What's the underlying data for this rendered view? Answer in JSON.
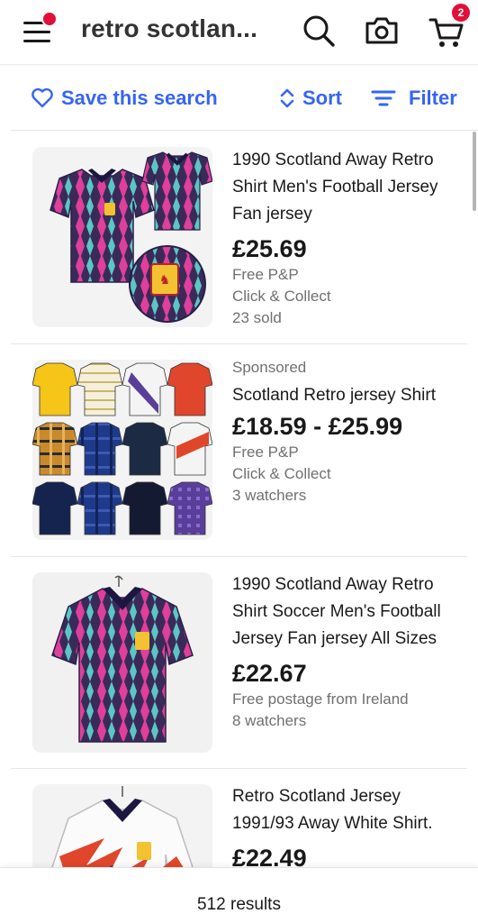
{
  "header": {
    "search_query": "retro scotlan...",
    "cart_count": "2"
  },
  "actions": {
    "save_search_label": "Save this search",
    "sort_label": "Sort",
    "filter_label": "Filter"
  },
  "colors": {
    "accent": "#3665f3",
    "badge": "#e0103a"
  },
  "listings": [
    {
      "title": "1990 Scotland Away Retro Shirt Men's Football Jersey Fan jersey",
      "price": "£25.69",
      "meta": [
        "Free P&P",
        "Click & Collect",
        "23 sold"
      ]
    },
    {
      "sponsored": "Sponsored",
      "title": "Scotland Retro jersey Shirt",
      "price": "£18.59 - £25.99",
      "meta": [
        "Free P&P",
        "Click & Collect",
        "3 watchers"
      ]
    },
    {
      "title": "1990 Scotland Away Retro Shirt Soccer Men's Football Jersey Fan jersey All Sizes",
      "price": "£22.67",
      "meta": [
        "Free postage from Ireland",
        "8 watchers"
      ]
    },
    {
      "title": "Retro Scotland Jersey 1991/93 Away White Shirt.",
      "price": "£22.49"
    }
  ],
  "footer": {
    "results": "512 results"
  }
}
